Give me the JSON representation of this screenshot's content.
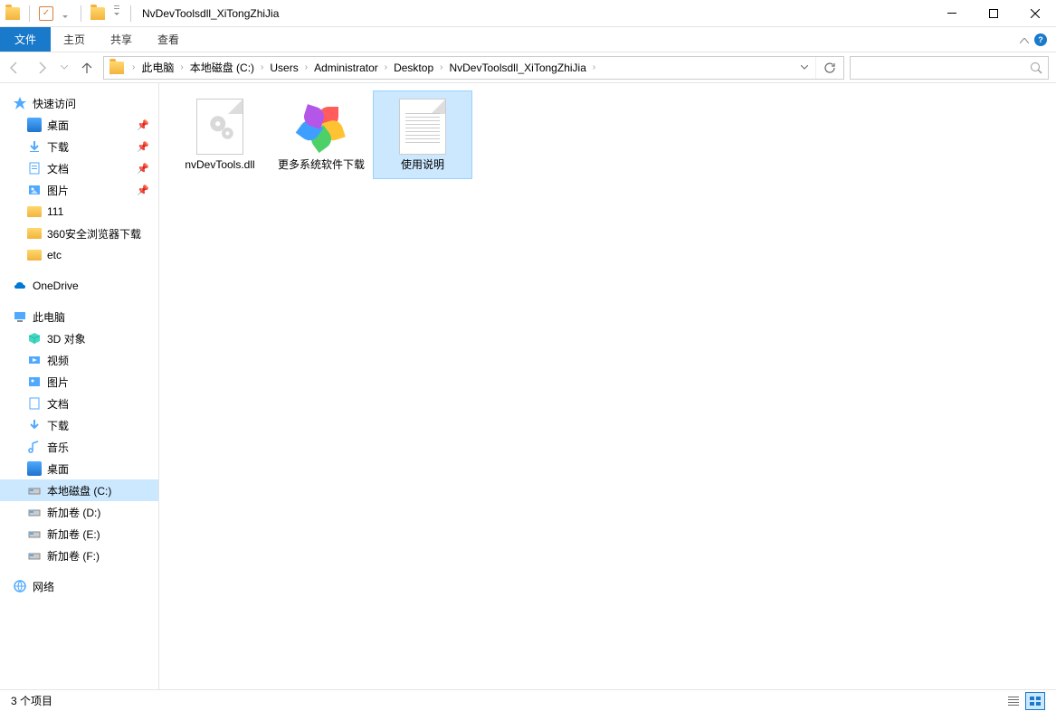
{
  "title": "NvDevToolsdll_XiTongZhiJia",
  "menu": {
    "file": "文件",
    "home": "主页",
    "share": "共享",
    "view": "查看"
  },
  "breadcrumb": [
    "此电脑",
    "本地磁盘 (C:)",
    "Users",
    "Administrator",
    "Desktop",
    "NvDevToolsdll_XiTongZhiJia"
  ],
  "search_placeholder": "",
  "sidebar": {
    "quick_access": "快速访问",
    "desktop": "桌面",
    "downloads": "下载",
    "documents": "文档",
    "pictures": "图片",
    "folder_111": "111",
    "folder_360": "360安全浏览器下载",
    "folder_etc": "etc",
    "onedrive": "OneDrive",
    "this_pc": "此电脑",
    "objects_3d": "3D 对象",
    "videos": "视频",
    "pictures2": "图片",
    "documents2": "文档",
    "downloads2": "下载",
    "music": "音乐",
    "desktop2": "桌面",
    "disk_c": "本地磁盘 (C:)",
    "disk_d": "新加卷 (D:)",
    "disk_e": "新加卷 (E:)",
    "disk_f": "新加卷 (F:)",
    "network": "网络"
  },
  "files": {
    "nvdevtools": "nvDevTools.dll",
    "more_software": "更多系统软件下载",
    "usage": "使用说明"
  },
  "status": "3 个项目"
}
